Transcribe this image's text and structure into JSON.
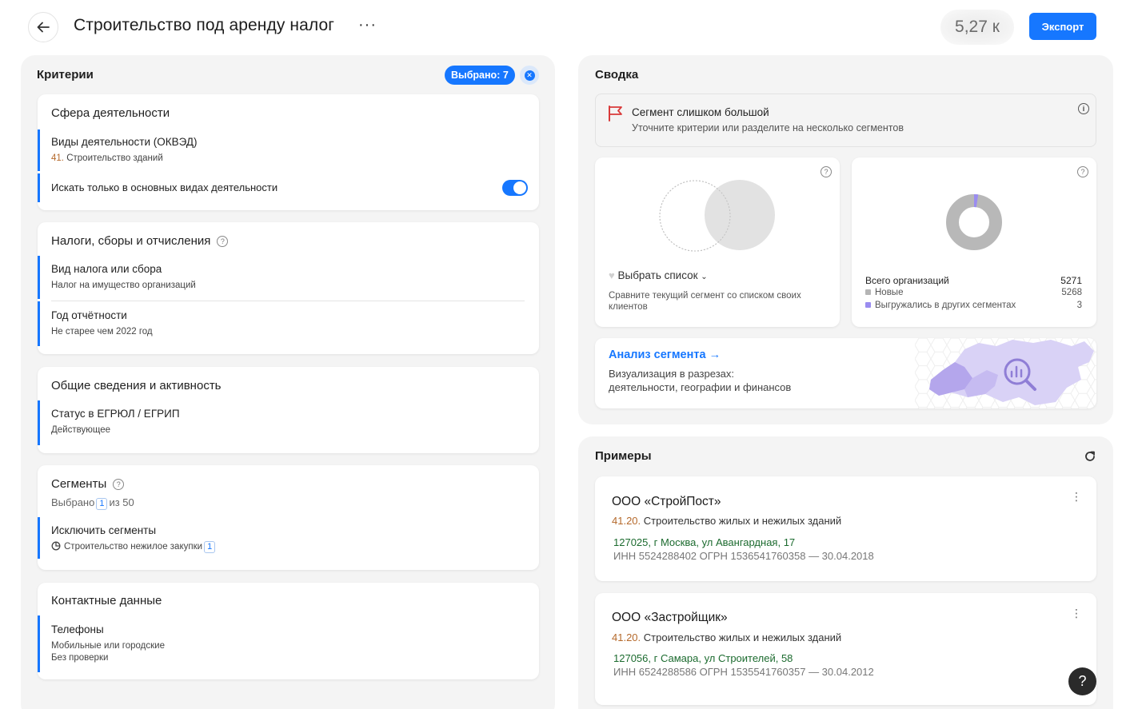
{
  "header": {
    "title": "Строительство под аренду налог",
    "more": "···",
    "count": "5,27 к",
    "export_label": "Экспорт"
  },
  "criteria": {
    "title": "Критерии",
    "selected": "Выбрано: 7",
    "activity": {
      "title": "Сфера деятельности",
      "okved_name": "Виды деятельности (ОКВЭД)",
      "okved_code": "41.",
      "okved_value": "Строительство зданий",
      "main_only": "Искать только в основных видах деятельности",
      "main_only_on": true
    },
    "taxes": {
      "title": "Налоги, сборы и отчисления",
      "type_name": "Вид налога или сбора",
      "type_value": "Налог на имущество организаций",
      "year_name": "Год отчётности",
      "year_value": "Не старее чем 2022 год"
    },
    "general": {
      "title": "Общие сведения и активность",
      "status_name": "Статус в ЕГРЮЛ / ЕГРИП",
      "status_value": "Действующее"
    },
    "segments": {
      "title": "Сегменты",
      "selected_prefix": "Выбрано",
      "selected_count": "1",
      "selected_suffix": "из 50",
      "exclude_name": "Исключить сегменты",
      "exclude_value": "Строительство нежилое закупки",
      "exclude_count": "1"
    },
    "contacts": {
      "title": "Контактные данные",
      "phones_name": "Телефоны",
      "phones_value1": "Мобильные или городские",
      "phones_value2": "Без проверки"
    }
  },
  "summary": {
    "title": "Сводка",
    "warning_title": "Сегмент слишком большой",
    "warning_sub": "Уточните критерии или разделите на несколько сегментов",
    "compare_label": "Выбрать список",
    "compare_sub": "Сравните текущий сегмент со списком своих клиентов",
    "total_label": "Всего организаций",
    "total_value": "5271",
    "new_label": "Новые",
    "new_value": "5268",
    "exported_label": "Выгружались в других сегментах",
    "exported_value": "3",
    "new_color": "#b5b5b5",
    "exported_color": "#9a8cf0",
    "analysis_link": "Анализ сегмента →",
    "analysis_sub1": "Визуализация в разрезах:",
    "analysis_sub2": "деятельности, географии и финансов"
  },
  "examples": {
    "title": "Примеры",
    "orgs": [
      {
        "name": "ООО «СтройПост»",
        "okved_code": "41.20.",
        "okved_name": "Строительство жилых и нежилых зданий",
        "address": "127025, г Москва,  ул Авангардная, 17",
        "ids": "ИНН 5524288402   ОГРН 1536541760358 — 30.04.2018"
      },
      {
        "name": "ООО «Застройщик»",
        "okved_code": "41.20.",
        "okved_name": "Строительство жилых и нежилых зданий",
        "address": "127056, г Самара,  ул Строителей, 58",
        "ids": "ИНН 6524288586   ОГРН 1535541760357 — 30.04.2012"
      }
    ]
  },
  "help_fab": "?"
}
